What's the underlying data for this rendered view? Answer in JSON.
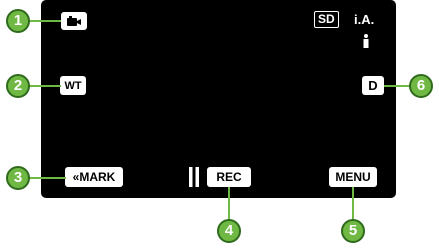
{
  "screen": {
    "mode_icon": "video-camera-icon",
    "status": {
      "media": "SD",
      "scene": "i.A.",
      "person_icon": "person-icon"
    },
    "buttons": {
      "wt": "WT",
      "mark": "«MARK",
      "pause_icon": "pause-icon",
      "rec": "REC",
      "menu": "MENU",
      "display": "D"
    }
  },
  "callouts": [
    "1",
    "2",
    "3",
    "4",
    "5",
    "6"
  ],
  "colors": {
    "screen_bg": "#000000",
    "button_bg": "#ffffff",
    "callout_fill": "#6fb844",
    "callout_border": "#2e6b1c"
  }
}
